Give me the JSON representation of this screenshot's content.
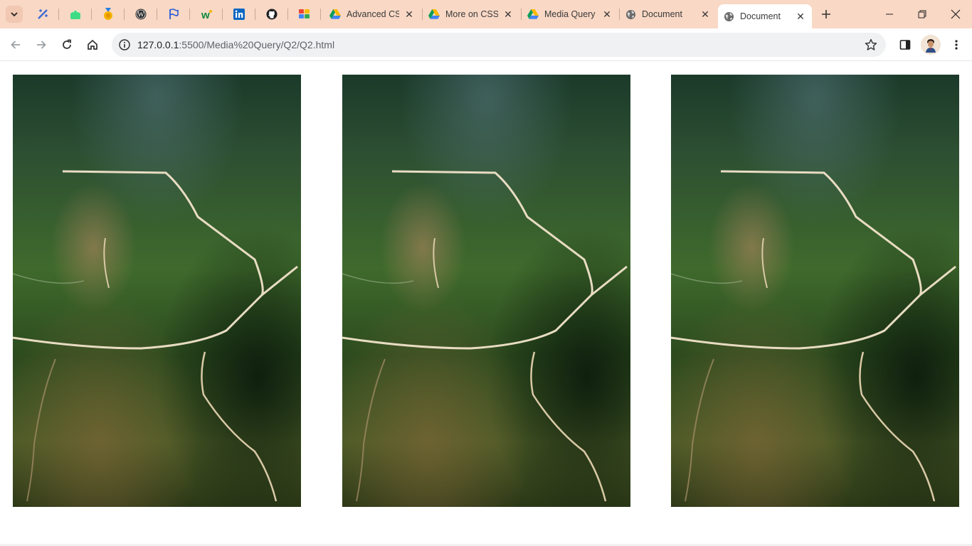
{
  "tabs": {
    "pinned_icons": [
      "ai-tool-icon",
      "android-icon",
      "medal-icon",
      "wordpress-icon",
      "flag-icon",
      "w-icon",
      "linkedin-icon",
      "github-icon",
      "apps-icon"
    ],
    "items": [
      {
        "title": "Advanced CSS",
        "icon": "google-drive-icon"
      },
      {
        "title": "More on CSS",
        "icon": "google-drive-icon"
      },
      {
        "title": "Media Query",
        "icon": "google-drive-icon"
      },
      {
        "title": "Document",
        "icon": "globe-icon"
      },
      {
        "title": "Document",
        "icon": "globe-icon",
        "active": true
      }
    ]
  },
  "address_bar": {
    "host": "127.0.0.1",
    "path": ":5500/Media%20Query/Q2/Q2.html"
  },
  "page": {
    "images": [
      {
        "alt": "aerial landscape"
      },
      {
        "alt": "aerial landscape"
      },
      {
        "alt": "aerial landscape"
      }
    ]
  },
  "colors": {
    "titlebar": "#f9d8c5",
    "omnibox": "#eff1f2"
  }
}
